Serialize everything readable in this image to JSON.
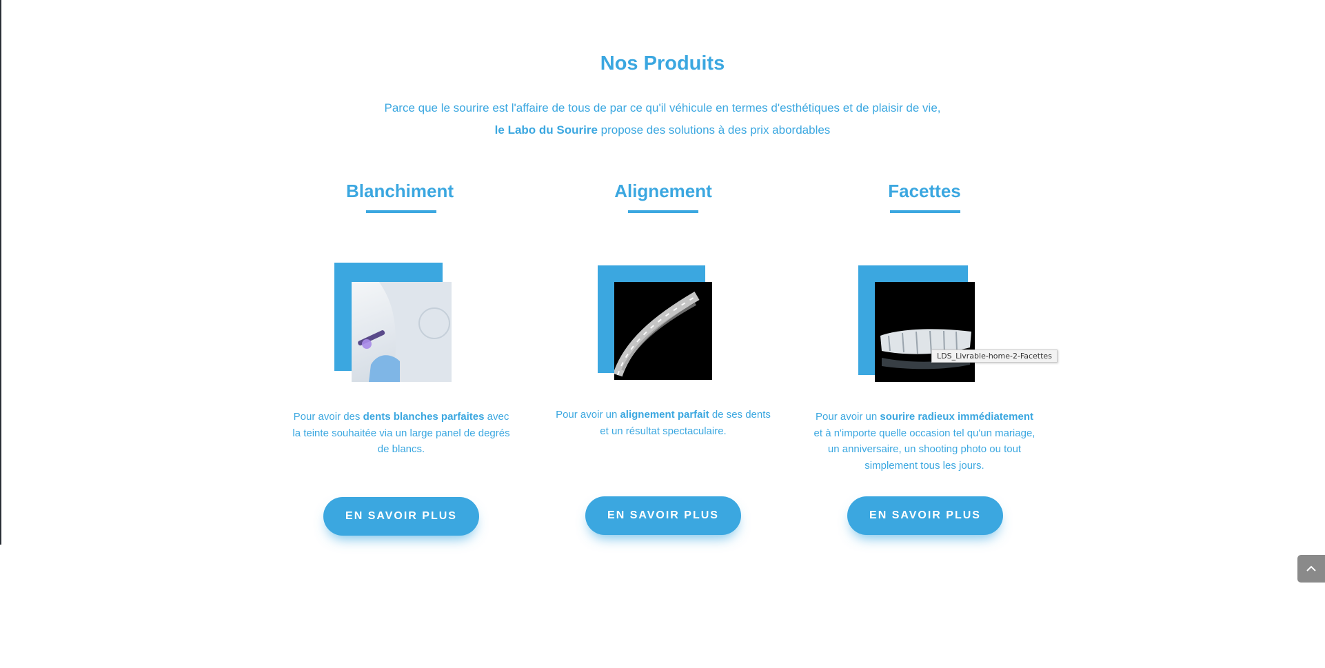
{
  "section": {
    "title": "Nos Produits",
    "intro_line1": "Parce que le sourire est l'affaire de tous de par ce qu'il véhicule en termes d'esthétiques et de plaisir de vie,",
    "intro_brand": "le Labo du Sourire",
    "intro_line2_rest": " propose des solutions à des prix abordables"
  },
  "products": [
    {
      "title": "Blanchiment",
      "desc_pre": "Pour avoir des ",
      "desc_bold": "dents blanches parfaites",
      "desc_post": " avec la teinte souhaitée via un large panel de degrés de blancs.",
      "button": "EN SAVOIR PLUS"
    },
    {
      "title": "Alignement",
      "desc_pre": "Pour avoir un ",
      "desc_bold": "alignement parfait",
      "desc_post": " de ses dents et un résultat spectaculaire.",
      "button": "EN SAVOIR PLUS"
    },
    {
      "title": "Facettes",
      "desc_pre": "Pour avoir un ",
      "desc_bold": "sourire radieux immédiatement",
      "desc_post": " et à n'importe quelle occasion tel qu'un mariage, un anniversaire, un shooting photo ou tout simplement tous les jours.",
      "button": "EN SAVOIR PLUS"
    }
  ],
  "tooltip": "LDS_Livrable-home-2-Facettes",
  "colors": {
    "accent": "#3ba7e0",
    "background": "#ffffff",
    "scroll_button": "#8a8a8a"
  },
  "icons": {
    "scroll_top": "chevron-up-icon"
  }
}
